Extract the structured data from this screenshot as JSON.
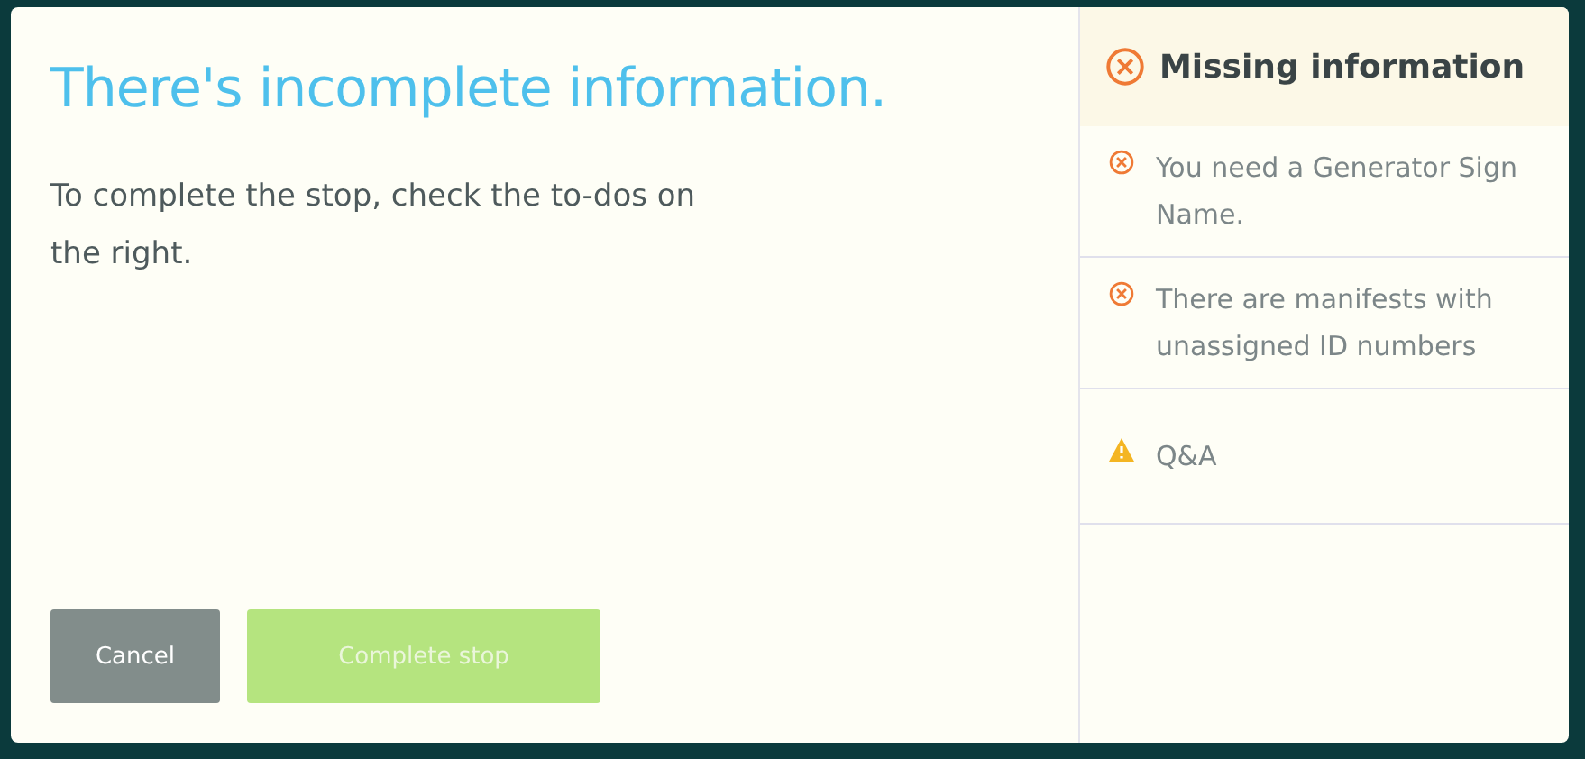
{
  "dialog": {
    "title": "There's incomplete information.",
    "message": "To complete the stop, check the to-dos on the right.",
    "buttons": [
      {
        "label": "Cancel",
        "kind": "secondary",
        "disabled": false
      },
      {
        "label": "Complete stop",
        "kind": "primary",
        "disabled": true
      }
    ]
  },
  "todo_panel": {
    "title": "Missing information",
    "items": [
      {
        "kind": "error",
        "text": "You need a Generator Sign Name."
      },
      {
        "kind": "error",
        "text": "There are manifests with unassigned ID numbers"
      },
      {
        "kind": "warning",
        "text": "Q&A"
      }
    ]
  }
}
